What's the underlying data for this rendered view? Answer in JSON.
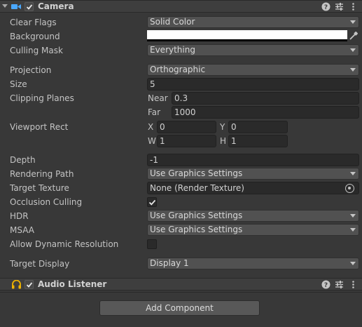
{
  "camera": {
    "title": "Camera",
    "enabled": true,
    "icons": [
      "camera-icon",
      "help-icon",
      "presets-icon",
      "more-icon"
    ],
    "fields": {
      "clear_flags": {
        "label": "Clear Flags",
        "value": "Solid Color"
      },
      "background": {
        "label": "Background",
        "color": "#ffffff"
      },
      "culling_mask": {
        "label": "Culling Mask",
        "value": "Everything"
      },
      "projection": {
        "label": "Projection",
        "value": "Orthographic"
      },
      "size": {
        "label": "Size",
        "value": "5"
      },
      "clipping_planes": {
        "label": "Clipping Planes",
        "near_label": "Near",
        "near": "0.3",
        "far_label": "Far",
        "far": "1000"
      },
      "viewport_rect": {
        "label": "Viewport Rect",
        "x_label": "X",
        "x": "0",
        "y_label": "Y",
        "y": "0",
        "w_label": "W",
        "w": "1",
        "h_label": "H",
        "h": "1"
      },
      "depth": {
        "label": "Depth",
        "value": "-1"
      },
      "rendering_path": {
        "label": "Rendering Path",
        "value": "Use Graphics Settings"
      },
      "target_texture": {
        "label": "Target Texture",
        "value": "None (Render Texture)"
      },
      "occlusion_culling": {
        "label": "Occlusion Culling",
        "checked": true
      },
      "hdr": {
        "label": "HDR",
        "value": "Use Graphics Settings"
      },
      "msaa": {
        "label": "MSAA",
        "value": "Use Graphics Settings"
      },
      "allow_dynamic_resolution": {
        "label": "Allow Dynamic Resolution",
        "checked": false
      },
      "target_display": {
        "label": "Target Display",
        "value": "Display 1"
      }
    }
  },
  "audio_listener": {
    "title": "Audio Listener",
    "enabled": true,
    "icons": [
      "headphones-icon",
      "help-icon",
      "presets-icon",
      "more-icon"
    ]
  },
  "add_component": {
    "label": "Add Component"
  },
  "colors": {
    "accent_camera": "#4aa8ff",
    "accent_audio": "#f0b400"
  }
}
